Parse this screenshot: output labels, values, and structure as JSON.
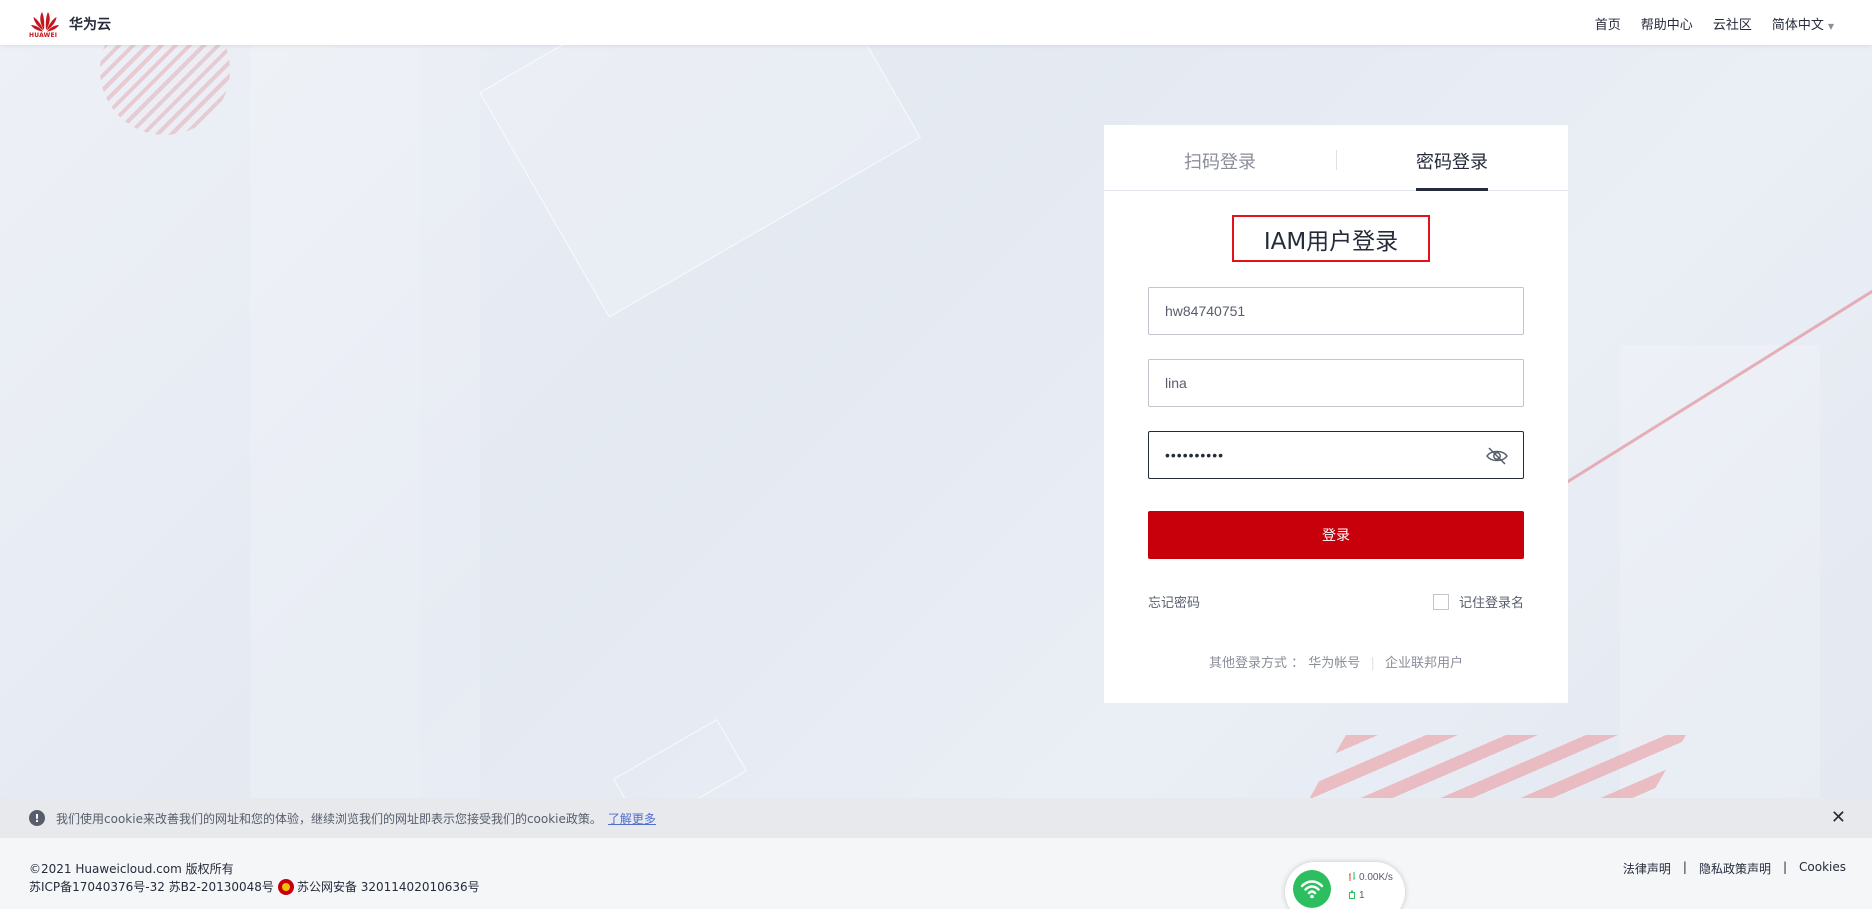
{
  "header": {
    "brand_text": "华为云",
    "logo_word": "HUAWEI",
    "nav": [
      {
        "label": "首页"
      },
      {
        "label": "帮助中心"
      },
      {
        "label": "云社区"
      },
      {
        "label": "简体中文"
      }
    ]
  },
  "login": {
    "tabs": [
      {
        "label": "扫码登录",
        "active": false
      },
      {
        "label": "密码登录",
        "active": true
      }
    ],
    "title": "IAM用户登录",
    "account_value": "hw84740751",
    "username_value": "lina",
    "password_value": "••••••••••",
    "submit_label": "登录",
    "forgot_label": "忘记密码",
    "remember_label": "记住登录名",
    "other_prefix": "其他登录方式 ：",
    "other_links": [
      {
        "label": "华为帐号"
      },
      {
        "label": "企业联邦用户"
      }
    ]
  },
  "cookie": {
    "text": "我们使用cookie来改善我们的网址和您的体验，继续浏览我们的网址即表示您接受我们的cookie政策。",
    "link": "了解更多",
    "info_icon_glyph": "!",
    "close_glyph": "✕"
  },
  "footer": {
    "copyright": "©2021 Huaweicloud.com 版权所有",
    "icp": "苏ICP备17040376号-32 苏B2-20130048号",
    "police": "苏公网安备 32011402010636号",
    "links": [
      {
        "label": "法律声明"
      },
      {
        "label": "隐私政策声明"
      },
      {
        "label": "Cookies"
      }
    ]
  },
  "network_widget": {
    "speed": "0.00K/s",
    "count": "1"
  },
  "colors": {
    "brand_red": "#c7000b",
    "highlight_border": "#e3121a",
    "link_blue": "#526ecc"
  }
}
